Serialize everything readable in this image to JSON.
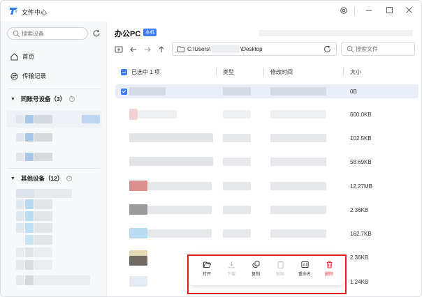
{
  "window": {
    "title": "文件中心"
  },
  "sidebar": {
    "search_placeholder": "搜索设备",
    "nav": [
      {
        "label": "首页",
        "icon": "home-icon"
      },
      {
        "label": "传输记录",
        "icon": "transfer-icon"
      }
    ],
    "groups": [
      {
        "label": "同账号设备（3）"
      },
      {
        "label": "其他设备（12）"
      }
    ]
  },
  "main": {
    "device_name": "办公PC",
    "device_badge": "本机",
    "path_prefix": "C:\\Users\\",
    "path_suffix": "\\Desktop",
    "file_search_placeholder": "搜索文件",
    "columns": {
      "selected_label": "已选中 1 项",
      "type": "类型",
      "modified": "修改时间",
      "size": "大小"
    },
    "rows": [
      {
        "size": "0B",
        "selected": true
      },
      {
        "size": "600.0KB"
      },
      {
        "size": "102.5KB"
      },
      {
        "size": "58.69KB"
      },
      {
        "size": "12.27MB"
      },
      {
        "size": "2.36KB"
      },
      {
        "size": "162.7KB"
      },
      {
        "size": "2.36KB"
      },
      {
        "size": "1.24KB"
      }
    ]
  },
  "action_bar": {
    "open": "打开",
    "download": "下载",
    "copy": "复制",
    "paste": "粘贴",
    "rename": "重命名",
    "delete": "删除"
  },
  "colors": {
    "accent": "#3d7cf5",
    "danger": "#e03a3a",
    "highlight": "#e02020"
  }
}
